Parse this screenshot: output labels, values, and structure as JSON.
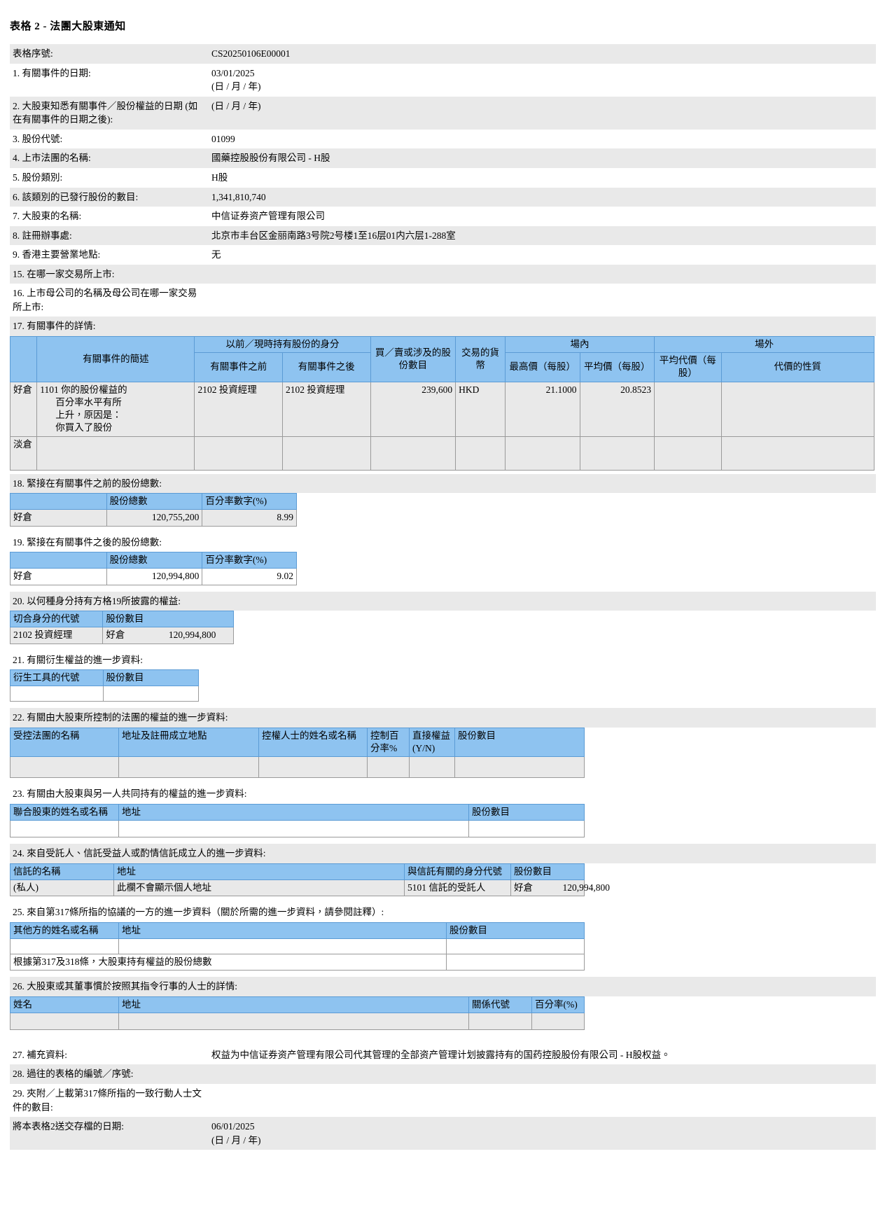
{
  "document": {
    "title": "表格 2 - 法團大股東通知"
  },
  "header_rows": [
    {
      "label": "表格序號:",
      "value": "CS20250106E00001",
      "sub": ""
    },
    {
      "label": "1. 有關事件的日期:",
      "value": "03/01/2025",
      "sub": "(日 / 月 / 年)"
    },
    {
      "label": "2. 大股東知悉有關事件／股份權益的日期 (如在有關事件的日期之後):",
      "value": "",
      "sub": "(日 / 月 / 年)"
    },
    {
      "label": "3. 股份代號:",
      "value": "01099",
      "sub": ""
    },
    {
      "label": "4. 上市法團的名稱:",
      "value": "國藥控股股份有限公司 - H股",
      "sub": ""
    },
    {
      "label": "5. 股份類別:",
      "value": "H股",
      "sub": ""
    },
    {
      "label": "6. 該類別的已發行股份的數目:",
      "value": "1,341,810,740",
      "sub": ""
    },
    {
      "label": "7. 大股東的名稱:",
      "value": "中信证券资产管理有限公司",
      "sub": ""
    },
    {
      "label": "8. 註冊辦事處:",
      "value": "北京市丰台区金丽南路3号院2号楼1至16层01内六层1-288室",
      "sub": ""
    },
    {
      "label": "9. 香港主要營業地點:",
      "value": "无",
      "sub": ""
    },
    {
      "label": "15. 在哪一家交易所上市:",
      "value": "",
      "sub": ""
    },
    {
      "label": "16. 上市母公司的名稱及母公司在哪一家交易所上市:",
      "value": "",
      "sub": ""
    }
  ],
  "section17": {
    "caption": "17. 有關事件的詳情:",
    "headers": {
      "tag": "",
      "brief": "有關事件的簡述",
      "capacity_group": "以前／現時持有股份的身分",
      "capacity_before": "有關事件之前",
      "capacity_after": "有關事件之後",
      "shares_involved": "買／賣或涉及的股份數目",
      "currency": "交易的貨幣",
      "onexchange_group": "場內",
      "highest_price": "最高價（每股）",
      "average_price": "平均價（每股）",
      "offexchange_group": "場外",
      "avg_consideration": "平均代價（每股）",
      "nature_consideration": "代價的性質"
    },
    "rows": [
      {
        "tag": "好倉",
        "brief": "1101 你的股份權益的百分率水平有所上升，原因是：你買入了股份",
        "brief_lines": [
          "1101 你的股份權益的",
          "百分率水平有所",
          "上升，原因是：",
          "你買入了股份"
        ],
        "capacity_before": "2102 投資經理",
        "capacity_after": "2102 投資經理",
        "shares_involved": "239,600",
        "currency": "HKD",
        "highest_price": "21.1000",
        "average_price": "20.8523",
        "avg_consideration": "",
        "nature_consideration": ""
      },
      {
        "tag": "淡倉",
        "brief": "",
        "brief_lines": [],
        "capacity_before": "",
        "capacity_after": "",
        "shares_involved": "",
        "currency": "",
        "highest_price": "",
        "average_price": "",
        "avg_consideration": "",
        "nature_consideration": ""
      }
    ]
  },
  "section18": {
    "caption": "18. 緊接在有關事件之前的股份總數:",
    "col_blank": "",
    "col_total": "股份總數",
    "col_pct": "百分率數字(%)",
    "row_tag": "好倉",
    "total": "120,755,200",
    "pct": "8.99"
  },
  "section19": {
    "caption": "19. 緊接在有關事件之後的股份總數:",
    "col_blank": "",
    "col_total": "股份總數",
    "col_pct": "百分率數字(%)",
    "row_tag": "好倉",
    "total": "120,994,800",
    "pct": "9.02"
  },
  "section20": {
    "caption": "20. 以何種身分持有方格19所披露的權益:",
    "col_code": "切合身分的代號",
    "col_shares": "股份數目",
    "row_code": "2102 投資經理",
    "row_tag": "好倉",
    "row_shares": "120,994,800"
  },
  "section21": {
    "caption": "21. 有關衍生權益的進一步資料:",
    "col_code": "衍生工具的代號",
    "col_shares": "股份數目",
    "row_code": "",
    "row_shares": ""
  },
  "section22": {
    "caption": "22. 有關由大股東所控制的法團的權益的進一步資料:",
    "col_name": "受控法團的名稱",
    "col_address": "地址及註冊成立地點",
    "col_controller": "控權人士的姓名或名稱",
    "col_pct": "控制百分率%",
    "col_direct": "直接權益 (Y/N)",
    "col_shares": "股份數目",
    "row": {
      "name": "",
      "address": "",
      "controller": "",
      "pct": "",
      "direct": "",
      "shares": ""
    }
  },
  "section23": {
    "caption": "23. 有關由大股東與另一人共同持有的權益的進一步資料:",
    "col_name": "聯合股東的姓名或名稱",
    "col_address": "地址",
    "col_shares": "股份數目",
    "row": {
      "name": "",
      "address": "",
      "shares": ""
    }
  },
  "section24": {
    "caption": "24. 來自受託人、信託受益人或酌情信託成立人的進一步資料:",
    "col_name": "信託的名稱",
    "col_address": "地址",
    "col_capacity": "與信託有關的身分代號",
    "col_shares": "股份數目",
    "row": {
      "name": "(私人)",
      "address": "此欄不會顯示個人地址",
      "capacity": "5101 信託的受託人",
      "tag": "好倉",
      "shares": "120,994,800"
    }
  },
  "section25": {
    "caption": "25. 來自第317條所指的協議的一方的進一步資料（關於所需的進一步資料，請參閱註釋）:",
    "col_name": "其他方的姓名或名稱",
    "col_address": "地址",
    "col_shares": "股份數目",
    "row": {
      "name": "",
      "address": "",
      "shares": ""
    },
    "total_label": "根據第317及318條，大股東持有權益的股份總數",
    "total_value": ""
  },
  "section26": {
    "caption": "26. 大股東或其董事慣於按照其指令行事的人士的詳情:",
    "col_name": "姓名",
    "col_address": "地址",
    "col_relation": "關係代號",
    "col_pct": "百分率(%)",
    "row": {
      "name": "",
      "address": "",
      "relation": "",
      "pct": ""
    }
  },
  "footer_rows": [
    {
      "label": "27. 補充資料:",
      "value": "权益为中信证券资产管理有限公司代其管理的全部资产管理计划披露持有的国药控股股份有限公司 - H股权益。",
      "sub": ""
    },
    {
      "label": "28. 過往的表格的編號／序號:",
      "value": "",
      "sub": ""
    },
    {
      "label": "29. 夾附／上載第317條所指的一致行動人士文件的數目:",
      "value": "",
      "sub": ""
    },
    {
      "label": "將本表格2送交存檔的日期:",
      "value": "06/01/2025",
      "sub": "(日 / 月 / 年)"
    }
  ],
  "colors": {
    "header_blue": "#8ec3f0",
    "row_shade": "#e9e9e9",
    "border": "#9a9a9a"
  }
}
